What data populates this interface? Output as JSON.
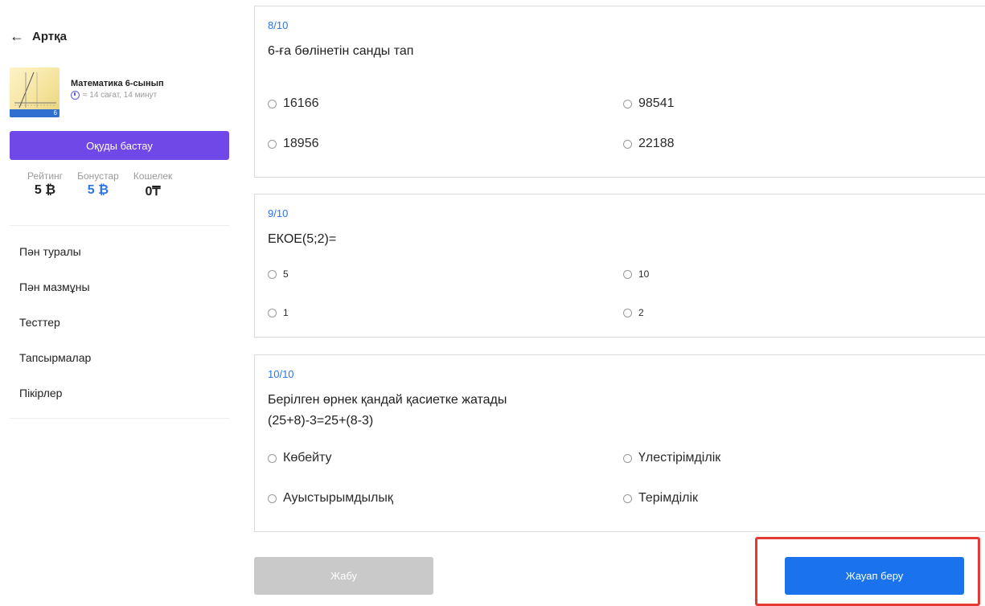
{
  "sidebar": {
    "back_label": "Артқа",
    "course": {
      "title": "Математика 6-сынып",
      "duration": "≈ 14 сағат, 14 минут",
      "badge_number": "6"
    },
    "start_button": "Оқуды бастау",
    "stats": [
      {
        "label": "Рейтинг",
        "value": "5 ₿"
      },
      {
        "label": "Бонустар",
        "value": "5 ₿"
      },
      {
        "label": "Кошелек",
        "value": "0₸"
      }
    ],
    "nav_items": [
      "Пән туралы",
      "Пән мазмұны",
      "Тесттер",
      "Тапсырмалар",
      "Пікірлер"
    ]
  },
  "questions": [
    {
      "number": "8/10",
      "text": "6-ға бөлінетін санды тап",
      "options": [
        "16166",
        "98541",
        "18956",
        "22188"
      ]
    },
    {
      "number": "9/10",
      "text": "ЕКОЕ(5;2)=",
      "options": [
        "5",
        "10",
        "1",
        "2"
      ]
    },
    {
      "number": "10/10",
      "text_line1": "Берілген өрнек қандай қасиетке жатады",
      "text_line2": "(25+8)-3=25+(8-3)",
      "options": [
        "Көбейту",
        "Үлестірімділік",
        "Ауыстырымдылық",
        "Терімділік"
      ]
    }
  ],
  "buttons": {
    "close": "Жабу",
    "submit": "Жауап беру"
  },
  "colors": {
    "accent_purple": "#7048e8",
    "question_number": "#2d74e6",
    "submit_blue": "#1a73ec",
    "highlight_red": "#e53935"
  }
}
